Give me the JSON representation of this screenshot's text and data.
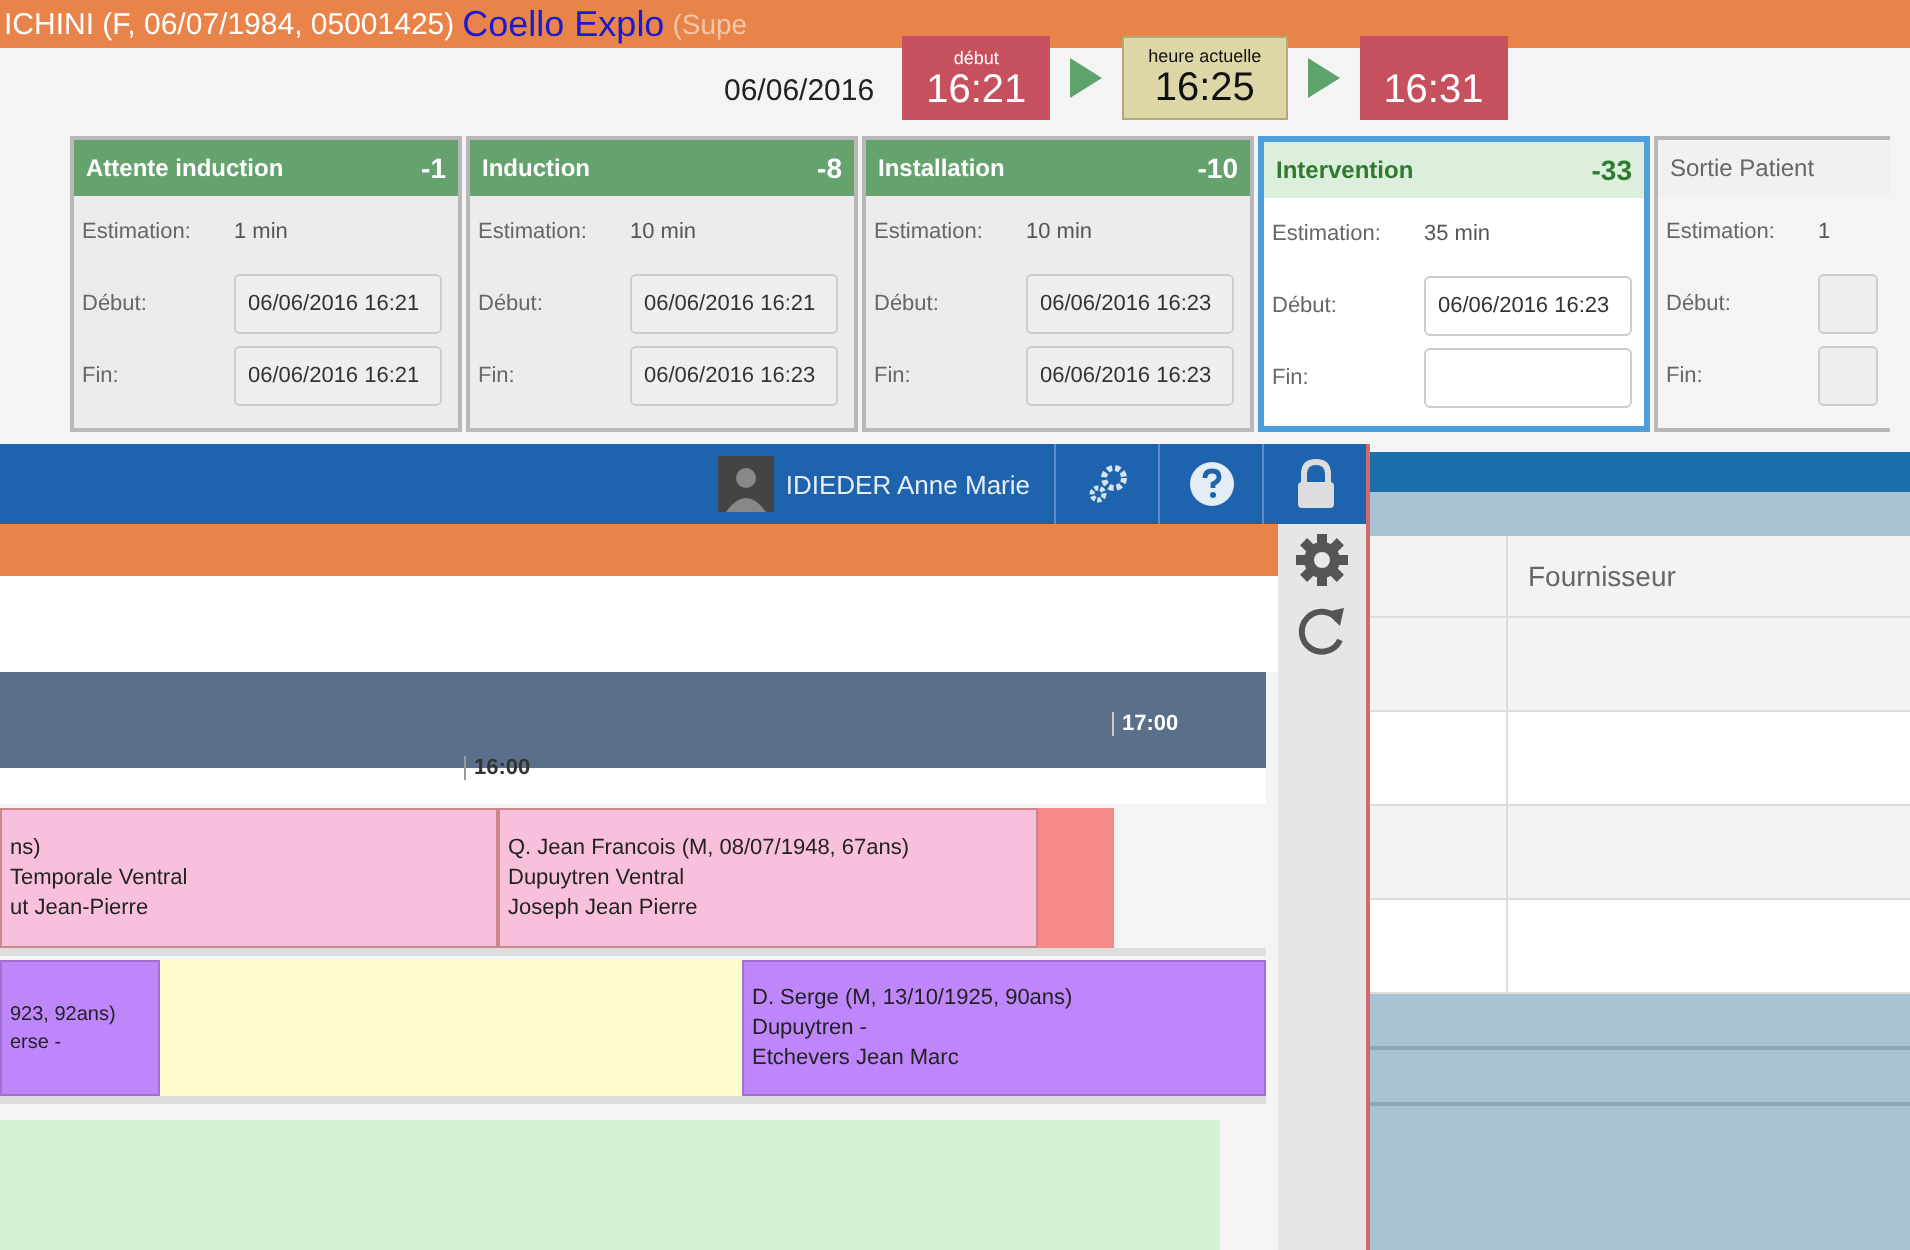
{
  "patient_bar": {
    "patient": "ICHINI (F, 06/07/1984, 05001425)",
    "location": "Coello Explo",
    "location_note": "(Supe"
  },
  "date": "06/06/2016",
  "timers": [
    {
      "kind": "start",
      "label": "début",
      "time": "16:21"
    },
    {
      "kind": "current",
      "label": "heure actuelle",
      "time": "16:25"
    },
    {
      "kind": "end",
      "time": "16:31"
    }
  ],
  "steps": [
    {
      "title": "Attente induction",
      "delta": "-1",
      "kind": "done",
      "fields": [
        {
          "kind": "text",
          "label": "Estimation:",
          "value": "1 min"
        },
        {
          "kind": "input",
          "label": "Début:",
          "value": "06/06/2016 16:21"
        },
        {
          "kind": "input",
          "label": "Fin:",
          "value": "06/06/2016 16:21"
        }
      ]
    },
    {
      "title": "Induction",
      "delta": "-8",
      "kind": "done",
      "fields": [
        {
          "kind": "text",
          "label": "Estimation:",
          "value": "10 min"
        },
        {
          "kind": "input",
          "label": "Début:",
          "value": "06/06/2016 16:21"
        },
        {
          "kind": "input",
          "label": "Fin:",
          "value": "06/06/2016 16:23"
        }
      ]
    },
    {
      "title": "Installation",
      "delta": "-10",
      "kind": "done",
      "fields": [
        {
          "kind": "text",
          "label": "Estimation:",
          "value": "10 min"
        },
        {
          "kind": "input",
          "label": "Début:",
          "value": "06/06/2016 16:23"
        },
        {
          "kind": "input",
          "label": "Fin:",
          "value": "06/06/2016 16:23"
        }
      ]
    },
    {
      "title": "Intervention",
      "delta": "-33",
      "kind": "active",
      "fields": [
        {
          "kind": "text",
          "label": "Estimation:",
          "value": "35 min"
        },
        {
          "kind": "input",
          "label": "Début:",
          "value": "06/06/2016 16:23"
        },
        {
          "kind": "input",
          "label": "Fin:"
        }
      ]
    },
    {
      "title": "Sortie Patient",
      "kind": "pending",
      "fields": [
        {
          "kind": "text",
          "label": "Estimation:",
          "value": "1"
        },
        {
          "kind": "input",
          "label": "Début:"
        },
        {
          "kind": "input",
          "label": "Fin:"
        }
      ]
    }
  ],
  "user_bar": {
    "user": "IDIEDER Anne Marie"
  },
  "timeline": {
    "ticks": [
      "16:00",
      "17:00"
    ]
  },
  "lanes": [
    {
      "kind": "pink",
      "events": [
        {
          "color": "#f9c0dc",
          "lines": [
            "ns)",
            "Temporale Ventral",
            "ut Jean-Pierre"
          ]
        },
        {
          "color": "#f9c0dc",
          "lines": [
            "Q. Jean Francois (M, 08/07/1948, 67ans)",
            "Dupuytren Ventral",
            "Joseph Jean Pierre"
          ]
        },
        {
          "color": "#f68a8a"
        }
      ]
    },
    {
      "kind": "yellow",
      "events": [
        {
          "color": "#bf86fb",
          "lines": [
            "923, 92ans)",
            "erse -"
          ]
        },
        {
          "color": "#bf86fb",
          "lines": [
            "D. Serge (M, 13/10/1925, 90ans)",
            "Dupuytren -",
            "Etchevers Jean Marc"
          ]
        }
      ]
    },
    {
      "kind": "green"
    }
  ],
  "supplier_table": {
    "columns": [
      "Fournisseur"
    ]
  }
}
